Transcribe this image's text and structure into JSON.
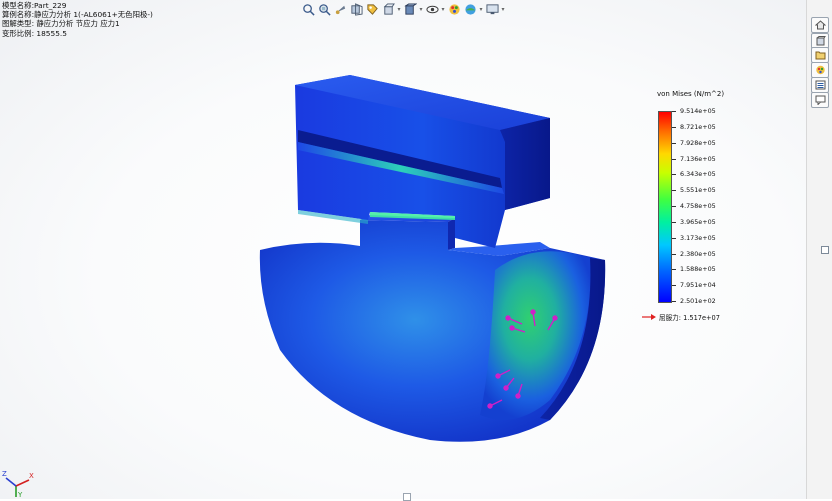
{
  "info": {
    "model_name": "模型名称:Part_229",
    "study_name": "算例名称:静应力分析 1(-AL6061+无色阳极-)",
    "plot_type": "图解类型: 静应力分析 节应力 应力1",
    "deformation_scale": "变形比例: 18555.5"
  },
  "toolbar": {
    "icons": [
      "zoom-to-fit-icon",
      "zoom-to-area-icon",
      "previous-view-icon",
      "section-view-icon",
      "dynamic-annotation-icon",
      "view-orientation-icon",
      "display-style-icon",
      "hide-show-icon",
      "edit-appearance-icon",
      "apply-scene-icon",
      "view-settings-icon"
    ]
  },
  "right_panel": {
    "icons": [
      "home-icon",
      "part-icon",
      "folder-icon",
      "appearance-icon",
      "list-icon",
      "comment-icon"
    ]
  },
  "legend": {
    "title": "von Mises (N/m^2)",
    "labels": [
      "9.514e+05",
      "8.721e+05",
      "7.928e+05",
      "7.136e+05",
      "6.343e+05",
      "5.551e+05",
      "4.758e+05",
      "3.965e+05",
      "3.173e+05",
      "2.380e+05",
      "1.588e+05",
      "7.951e+04",
      "2.501e+02"
    ],
    "yield_label": "屈服力: 1.517e+07",
    "colors": {
      "max": "#ff0000",
      "mid": "#40ff40",
      "min": "#0000ff"
    }
  },
  "triad": {
    "axes": [
      "X",
      "Y",
      "Z"
    ],
    "x_color": "#d42020",
    "y_color": "#2a9d2a",
    "z_color": "#2a3fd0"
  }
}
